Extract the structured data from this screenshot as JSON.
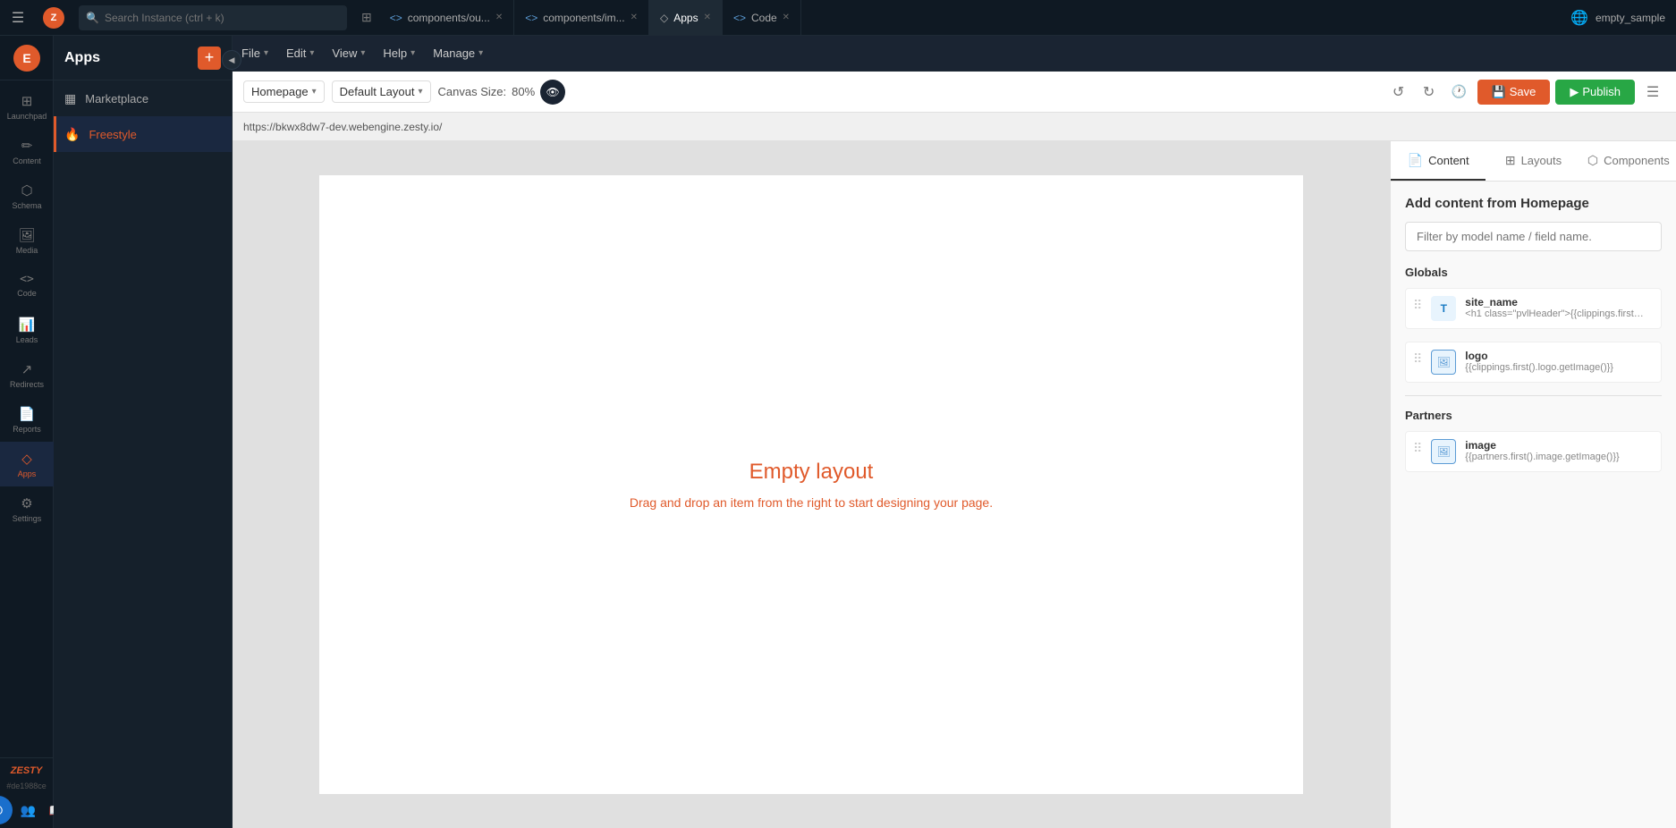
{
  "topbar": {
    "menu_icon": "☰",
    "search_placeholder": "Search Instance (ctrl + k)",
    "filter_icon": "⊞",
    "tabs": [
      {
        "label": "components/ou...",
        "icon": "<>",
        "active": false,
        "closable": true
      },
      {
        "label": "components/im...",
        "icon": "<>",
        "active": false,
        "closable": true
      },
      {
        "label": "Apps",
        "icon": "◇",
        "active": true,
        "closable": true
      },
      {
        "label": "Code",
        "icon": "<>",
        "active": false,
        "closable": true
      }
    ],
    "instance_name": "empty_sample",
    "globe_icon": "🌐"
  },
  "sidebar": {
    "user_initial": "E",
    "user_name": "empty_sample",
    "nav_items": [
      {
        "id": "launchpad",
        "label": "Launchpad",
        "icon": "⊞",
        "active": false
      },
      {
        "id": "content",
        "label": "Content",
        "icon": "✏",
        "active": false
      },
      {
        "id": "schema",
        "label": "Schema",
        "icon": "⬡",
        "active": false
      },
      {
        "id": "media",
        "label": "Media",
        "icon": "🖼",
        "active": false
      },
      {
        "id": "code",
        "label": "Code",
        "icon": "<>",
        "active": false
      },
      {
        "id": "leads",
        "label": "Leads",
        "icon": "📊",
        "active": false
      },
      {
        "id": "redirects",
        "label": "Redirects",
        "icon": "↗",
        "active": false
      },
      {
        "id": "reports",
        "label": "Reports",
        "icon": "📄",
        "active": false
      },
      {
        "id": "apps",
        "label": "Apps",
        "icon": "◇",
        "active": true
      },
      {
        "id": "settings",
        "label": "Settings",
        "icon": "⚙",
        "active": false
      }
    ],
    "footer": {
      "zesty_label": "ZESTY",
      "hash": "#de1988ce",
      "power_icon": "⏻"
    }
  },
  "apps_panel": {
    "title": "Apps",
    "add_button": "+",
    "items": [
      {
        "id": "marketplace",
        "label": "Marketplace",
        "icon": "▦",
        "active": false
      },
      {
        "id": "freestyle",
        "label": "Freestyle",
        "icon": "🔥",
        "active": true
      }
    ],
    "collapse_icon": "◀"
  },
  "secondary_toolbar": {
    "menus": [
      {
        "label": "File",
        "has_arrow": true
      },
      {
        "label": "Edit",
        "has_arrow": true
      },
      {
        "label": "View",
        "has_arrow": true
      },
      {
        "label": "Help",
        "has_arrow": true
      },
      {
        "label": "Manage",
        "has_arrow": true
      }
    ]
  },
  "page_toolbar": {
    "homepage_label": "Homepage",
    "layout_label": "Default Layout",
    "canvas_size_label": "Canvas Size:",
    "canvas_size_value": "80%",
    "undo_icon": "↺",
    "redo_icon": "↻",
    "save_history_icon": "🕐",
    "save_label": "Save",
    "publish_label": "Publish",
    "hamburger_icon": "☰"
  },
  "url_bar": {
    "url": "https://bkwx8dw7-dev.webengine.zesty.io/"
  },
  "canvas": {
    "empty_title": "Empty layout",
    "empty_subtitle": "Drag and drop an item from the right to start designing your page."
  },
  "right_panel": {
    "tabs": [
      {
        "id": "content",
        "label": "Content",
        "icon": "📄",
        "active": true
      },
      {
        "id": "layouts",
        "label": "Layouts",
        "icon": "⊞",
        "active": false
      },
      {
        "id": "components",
        "label": "Components",
        "icon": "⬡",
        "active": false
      }
    ],
    "section_title": "Add content from Homepage",
    "filter_placeholder": "Filter by model name / field name.",
    "globals_label": "Globals",
    "globals_fields": [
      {
        "id": "site_name",
        "name": "site_name",
        "value": "<h1 class=\"pvlHeader\">{{clippings.first().site_...",
        "type": "text"
      },
      {
        "id": "logo",
        "name": "logo",
        "value": "{{clippings.first().logo.getImage()}}",
        "type": "image"
      }
    ],
    "partners_label": "Partners",
    "partners_fields": [
      {
        "id": "image",
        "name": "image",
        "value": "{{partners.first().image.getImage()}}",
        "type": "image"
      }
    ]
  }
}
